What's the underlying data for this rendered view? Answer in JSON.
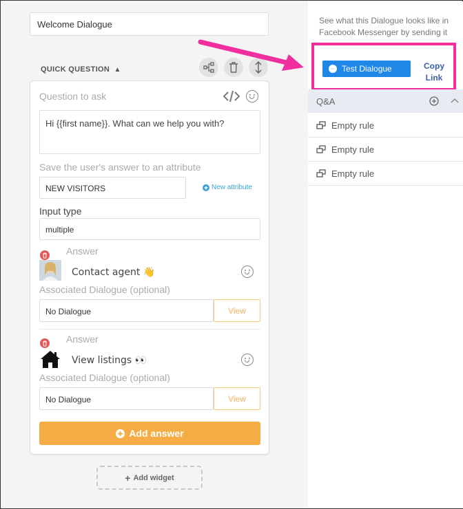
{
  "dialogue_title": "Welcome Dialogue",
  "section": {
    "title": "QUICK QUESTION",
    "collapse_icon": "chevron-up-icon"
  },
  "toolbar": {
    "icons": [
      "flow-icon",
      "trash-icon",
      "resize-icon"
    ]
  },
  "question": {
    "label": "Question to ask",
    "text": "Hi {{first name}}. What can we help you with?"
  },
  "attribute": {
    "label": "Save the user's answer to an attribute",
    "value": "NEW VISITORS",
    "new_link": "New attribute"
  },
  "input_type": {
    "label": "Input type",
    "value": "multiple"
  },
  "answers": [
    {
      "label": "Answer",
      "text": "Contact agent 👋",
      "assoc_label": "Associated Dialogue (optional)",
      "dialogue": "No Dialogue",
      "view": "View"
    },
    {
      "label": "Answer",
      "text": "View listings 👀",
      "assoc_label": "Associated Dialogue (optional)",
      "dialogue": "No Dialogue",
      "view": "View"
    }
  ],
  "add_answer": "Add answer",
  "add_widget": "Add widget",
  "right_panel": {
    "help_text": "See what this Dialogue looks like in Facebook Messenger by sending it",
    "test_button": "Test Dialogue",
    "copy_link": "Copy Link",
    "qa_header": "Q&A",
    "rules": [
      "Empty rule",
      "Empty rule",
      "Empty rule"
    ]
  },
  "colors": {
    "accent_orange": "#f5ac45",
    "messenger_blue": "#1f87e8",
    "highlight_pink": "#f02e9d",
    "delete_red": "#e05a5a",
    "link_blue": "#3a9fd6"
  }
}
